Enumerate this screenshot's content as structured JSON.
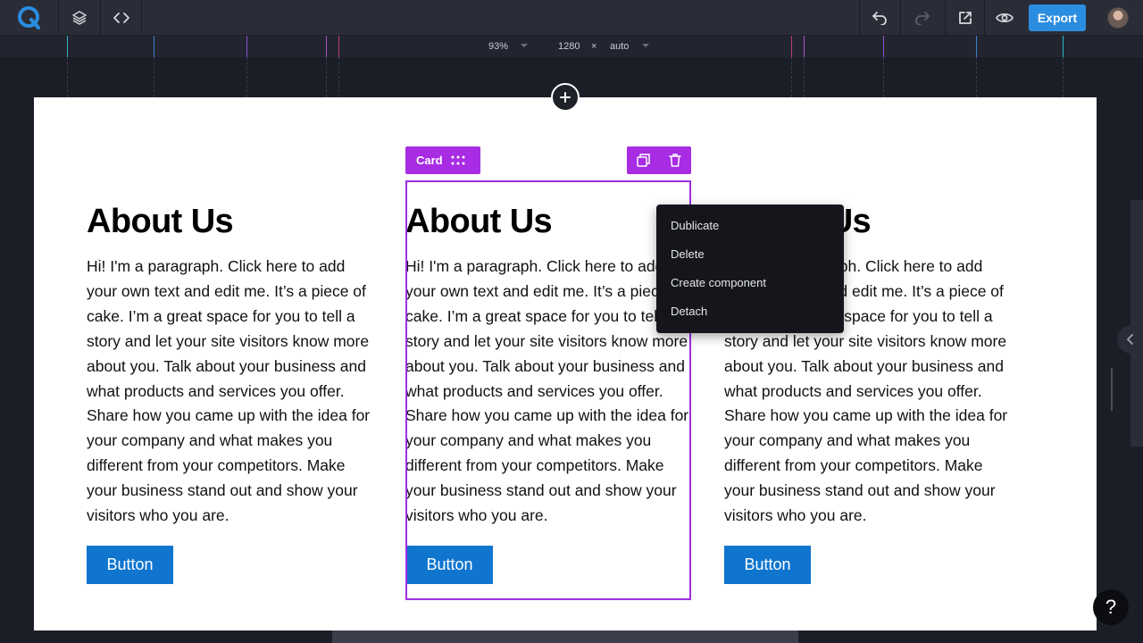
{
  "toolbar": {
    "export_label": "Export"
  },
  "ruler": {
    "zoom": "93%",
    "width": "1280",
    "times": "×",
    "height": "auto"
  },
  "cards": [
    {
      "title": "About Us",
      "paragraph": "Hi! I'm a paragraph. Click here to add your own text and edit me. It’s a piece of cake. I’m a great space for you to tell a story and let your site visitors know more about you. Talk about your business and what products and services you offer. Share how you came up with the idea for your company and what makes you different from your competitors. Make your business stand out and show your visitors who you are.",
      "button": "Button"
    },
    {
      "title": "About Us",
      "paragraph": "Hi! I'm a paragraph. Click here to add your own text and edit me. It’s a piece of cake. I’m a great space for you to tell a story and let your site visitors know more about you. Talk about your business and what products and services you offer. Share how you came up with the idea for your company and what makes you different from your competitors. Make your business stand out and show your visitors who you are.",
      "button": "Button"
    },
    {
      "title": "About Us",
      "paragraph": "Hi! I'm a paragraph. Click here to add your own text and edit me. It’s a piece of cake. I’m a great space for you to tell a story and let your site visitors know more about you. Talk about your business and what products and services you offer. Share how you came up with the idea for your company and what makes you different from your competitors. Make your business stand out and show your visitors who you are.",
      "button": "Button"
    }
  ],
  "selection": {
    "tag_label": "Card"
  },
  "context_menu": {
    "items": [
      "Dublicate",
      "Delete",
      "Create component",
      "Detach"
    ]
  },
  "help_label": "?",
  "icons": {
    "logo": "q-logo-icon",
    "layers": "layers-icon",
    "code": "code-icon",
    "undo": "undo-icon",
    "redo": "redo-icon",
    "open": "external-link-icon",
    "preview": "eye-icon",
    "add": "plus-icon",
    "drag": "drag-handle-icon",
    "copy": "copy-icon",
    "trash": "trash-icon",
    "panel": "chevron-left-icon"
  },
  "colors": {
    "accent": "#a72ce3",
    "export": "#2b8de0",
    "button": "#0f75cf"
  }
}
